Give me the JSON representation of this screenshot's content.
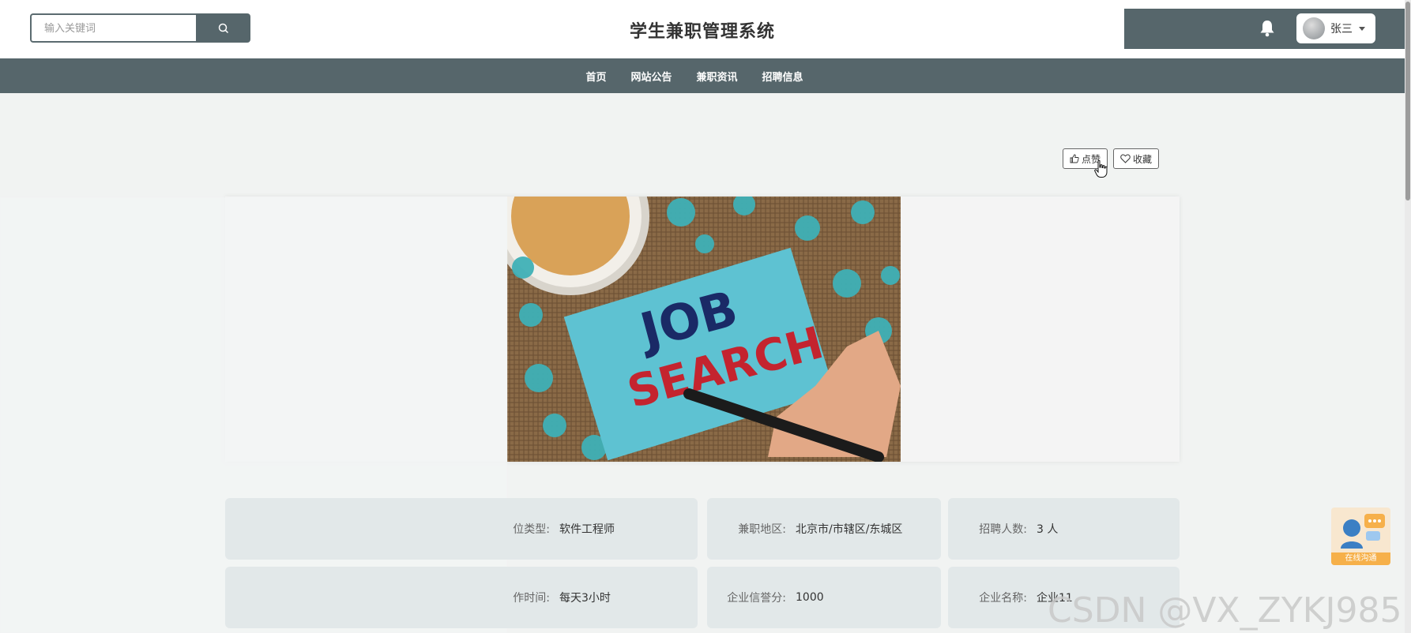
{
  "header": {
    "search_placeholder": "输入关键词",
    "title": "学生兼职管理系统",
    "user_name": "张三",
    "icons": {
      "search": "search-icon",
      "bell": "bell-icon"
    }
  },
  "nav": [
    "首页",
    "网站公告",
    "兼职资讯",
    "招聘信息"
  ],
  "actions": {
    "like": "点赞",
    "favorite": "收藏"
  },
  "banner": {
    "image_words": [
      "JOB",
      "SEARCH"
    ]
  },
  "details": [
    {
      "label": "位类型:",
      "value": "软件工程师"
    },
    {
      "label": "兼职地区:",
      "value": "北京市/市辖区/东城区"
    },
    {
      "label": "招聘人数:",
      "value": "3 人"
    },
    {
      "label": "作时间:",
      "value": "每天3小时"
    },
    {
      "label": "企业信誉分:",
      "value": "1000"
    },
    {
      "label": "企业名称:",
      "value": "企业11"
    }
  ],
  "chat": {
    "label": "在线沟通"
  },
  "watermark": "CSDN @VX_ZYKJ985",
  "colors": {
    "primary": "#56666b",
    "background": "#f1f3f2",
    "cell": "#e2e8e9",
    "accent": "#f6b04a"
  }
}
